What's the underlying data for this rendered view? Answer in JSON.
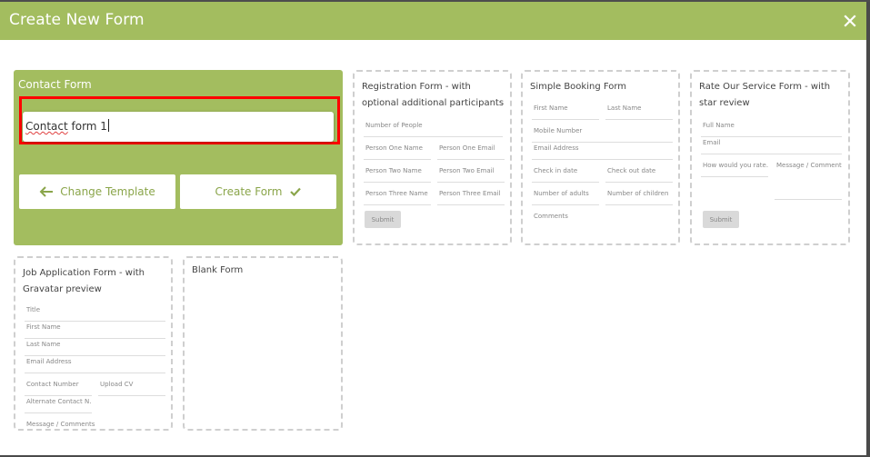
{
  "modal": {
    "title": "Create New Form",
    "close_icon": "close-icon",
    "header_color": "#a3bd5f"
  },
  "selected_template": {
    "title": "Contact Form",
    "name_input": {
      "value_word1": "Contact",
      "value_rest": " form 1",
      "value": "Contact form 1"
    },
    "change_template_label": "Change Template",
    "change_template_icon": "arrow-left-icon",
    "create_form_label": "Create Form",
    "create_form_icon": "checkmark-icon",
    "accent_color": "#a3bd5f",
    "highlight_color": "#ff0000"
  },
  "templates": [
    {
      "title": "Registration Form - with optional additional participants",
      "fields": [
        "Number of People",
        "Person One Name",
        "Person One Email",
        "Person Two Name",
        "Person Two Email",
        "Person Three Name",
        "Person Three Email"
      ],
      "submit": "Submit"
    },
    {
      "title": "Simple Booking Form",
      "fields": [
        "First Name",
        "Last Name",
        "Mobile Number",
        "Email Address",
        "Check in date",
        "Check out date",
        "Number of adults",
        "Number of children",
        "Comments"
      ]
    },
    {
      "title": "Rate Our Service Form - with star review",
      "fields": [
        "Full Name",
        "Email",
        "How would you rate...",
        "Message / Comments"
      ],
      "submit": "Submit"
    },
    {
      "title": "Job Application Form - with Gravatar preview",
      "fields": [
        "Title",
        "First Name",
        "Last Name",
        "Email Address",
        "Contact Number",
        "Upload CV",
        "Alternate Contact N...",
        "Message / Comments"
      ]
    },
    {
      "title": "Blank Form"
    }
  ]
}
